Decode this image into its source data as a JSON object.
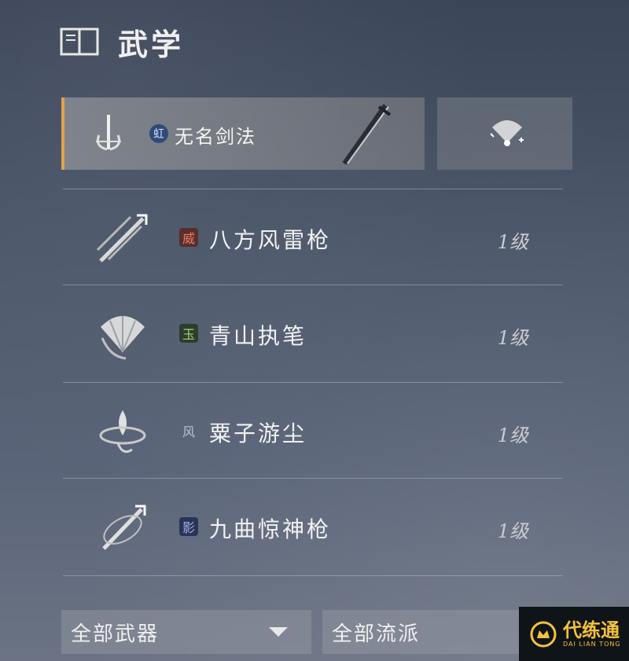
{
  "header": {
    "title": "武学",
    "icon": "book-icon"
  },
  "selected": {
    "badge": "虹",
    "name": "无名剑法",
    "icon": "sword-stance-icon"
  },
  "side_button": {
    "icon": "fan-switch-icon"
  },
  "skills": [
    {
      "badge": "威",
      "badge_color": "#b24a3a",
      "name": "八方风雷枪",
      "level": "1级",
      "icon": "spear-thrust-icon"
    },
    {
      "badge": "玉",
      "badge_color": "#3f6a3c",
      "name": "青山执笔",
      "level": "1级",
      "icon": "fan-icon"
    },
    {
      "badge": "风",
      "badge_color": "#9aa0b0",
      "name": "粟子游尘",
      "level": "1级",
      "icon": "dust-swirl-icon"
    },
    {
      "badge": "影",
      "badge_color": "#3a4e86",
      "name": "九曲惊神枪",
      "level": "1级",
      "icon": "spear-swirl-icon"
    }
  ],
  "filters": {
    "weapon": "全部武器",
    "school": "全部流派"
  },
  "watermark": {
    "main": "代练通",
    "sub": "DAI LIAN TONG"
  },
  "colors": {
    "accent": "#e3a24a",
    "watermark": "#f5c23a"
  }
}
